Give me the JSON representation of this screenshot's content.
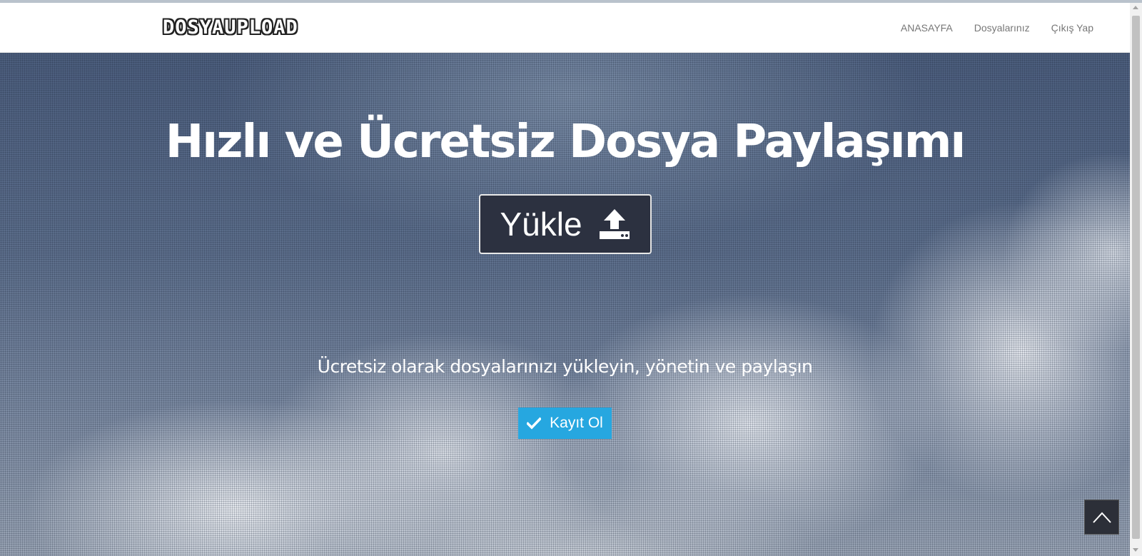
{
  "header": {
    "logo_text": "DOSYAUPLOAD",
    "nav": [
      {
        "label": "ANASAYFA"
      },
      {
        "label": "Dosyalarınız"
      },
      {
        "label": "Çıkış Yap"
      }
    ]
  },
  "hero": {
    "title": "Hızlı ve Ücretsiz Dosya Paylaşımı",
    "upload_label": "Yükle",
    "subtitle": "Ücretsiz olarak dosyalarınızı yükleyin, yönetin ve paylaşın",
    "register_label": "Kayıt Ol"
  },
  "icons": {
    "upload": "upload-icon",
    "register": "check-icon",
    "scroll_top": "chevron-up-icon"
  },
  "colors": {
    "register_accent": "#26a7e0",
    "upload_bg": "#2c3140"
  }
}
